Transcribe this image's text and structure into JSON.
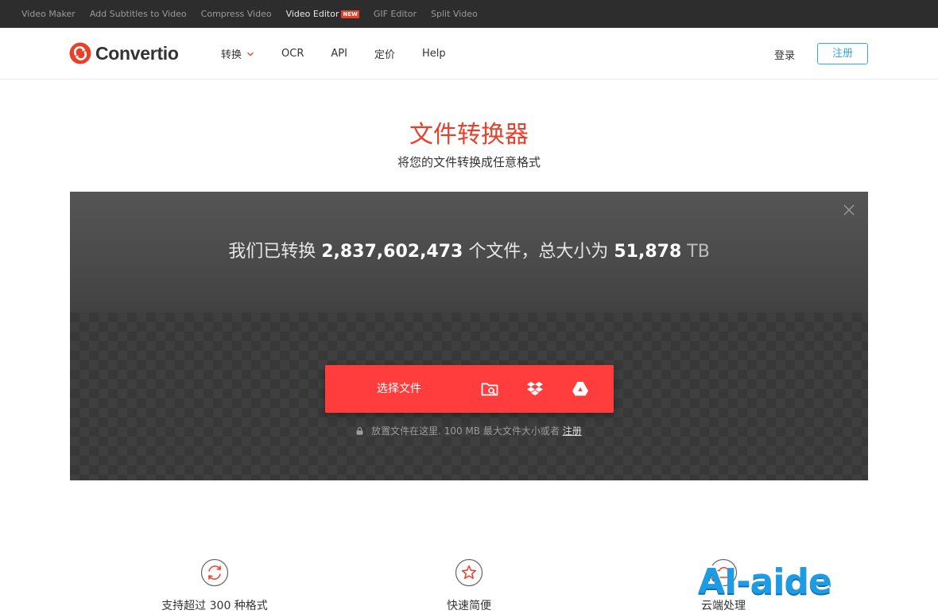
{
  "topbar": {
    "links": [
      {
        "label": "Video Maker"
      },
      {
        "label": "Add Subtitles to Video"
      },
      {
        "label": "Compress Video"
      },
      {
        "label": "Video Editor",
        "badge": "NEW"
      },
      {
        "label": "GIF Editor"
      },
      {
        "label": "Split Video"
      }
    ]
  },
  "header": {
    "logo_text": "Convertio",
    "nav": [
      {
        "label": "转换"
      },
      {
        "label": "OCR"
      },
      {
        "label": "API"
      },
      {
        "label": "定价"
      },
      {
        "label": "Help"
      }
    ],
    "login": "登录",
    "register": "注册"
  },
  "hero": {
    "title": "文件转换器",
    "subtitle": "将您的文件转换成任意格式"
  },
  "stats": {
    "prefix": "我们已转换",
    "files_count": "2,837,602,473",
    "middle": "个文件，总大小为",
    "total_size": "51,878",
    "unit": "TB"
  },
  "upload": {
    "choose_label": "选择文件",
    "sources": [
      "folder-search-icon",
      "dropbox-icon",
      "google-drive-icon"
    ],
    "hint_text": "放置文件在这里. 100 MB 最大文件大小或者",
    "hint_link": "注册"
  },
  "features": [
    {
      "icon": "refresh-icon",
      "label": "支持超过 300 种格式"
    },
    {
      "icon": "star-icon",
      "label": "快速简便"
    },
    {
      "icon": "cloud-icon",
      "label": "云端处理"
    }
  ],
  "watermark": "AI-aide",
  "colors": {
    "accent": "#e8412b",
    "button": "#ff3d3d",
    "link": "#39a8e0",
    "dark_bar": "#2d2d2d"
  }
}
